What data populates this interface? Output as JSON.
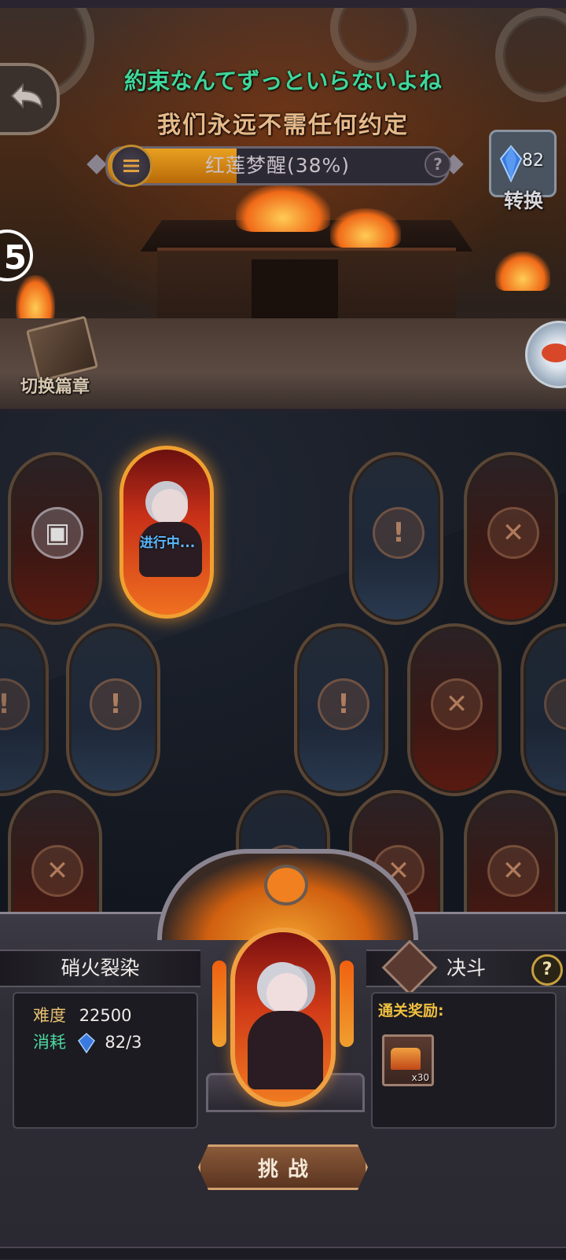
{
  "lyrics": {
    "jp": "約束なんてずっといらないよね",
    "cn": "我们永远不需任何约定"
  },
  "progress": {
    "label": "红莲梦醒(38%)",
    "fraction": 0.38
  },
  "currency": {
    "count": "82",
    "convert_label": "转换"
  },
  "side_number": "5",
  "chapter": {
    "switch_label": "切换篇章"
  },
  "board": {
    "active_status": "进行中..."
  },
  "stage": {
    "name": "硝火裂染",
    "type": "决斗",
    "difficulty_label": "难度",
    "difficulty_value": "22500",
    "cost_label": "消耗",
    "cost_value": "82/3",
    "reward_title": "通关奖励:",
    "reward_qty": "x30",
    "help": "?",
    "challenge_label": "挑战"
  },
  "colors": {
    "lyric_jp": "#3fd69a",
    "lyric_cn": "#e6b98a",
    "progress_fill": "#e8a020",
    "active_card_border": "#f0a030",
    "in_progress_text": "#5ab8ff",
    "reward_title": "#f0c040"
  }
}
